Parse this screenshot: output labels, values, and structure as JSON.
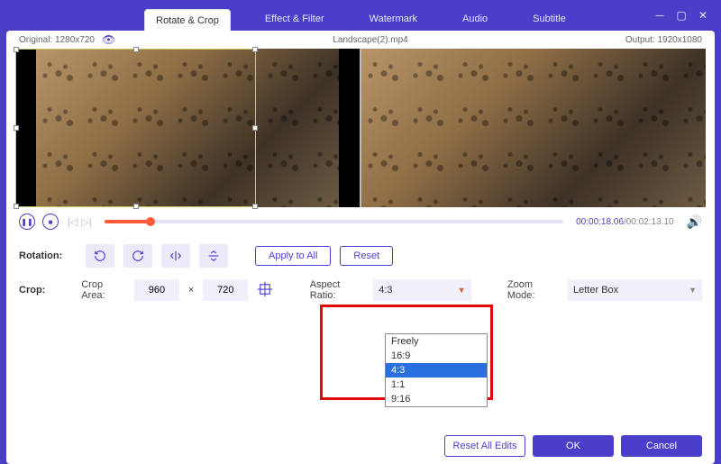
{
  "titlebar": {},
  "tabs": [
    "Rotate & Crop",
    "Effect & Filter",
    "Watermark",
    "Audio",
    "Subtitle"
  ],
  "active_tab_index": 0,
  "infobar": {
    "original_label": "Original:",
    "original_value": "1280x720",
    "filename": "Landscape(2).mp4",
    "output_label": "Output:",
    "output_value": "1920x1080"
  },
  "player": {
    "current": "00:00:18.06",
    "duration": "00:02:13.10"
  },
  "rotation": {
    "label": "Rotation:",
    "apply_all": "Apply to All",
    "reset": "Reset"
  },
  "crop": {
    "label": "Crop:",
    "area_label": "Crop Area:",
    "width": "960",
    "height": "720",
    "times": "×",
    "aspect_label": "Aspect Ratio:",
    "aspect_value": "4:3",
    "aspect_options": [
      "Freely",
      "16:9",
      "4:3",
      "1:1",
      "9:16"
    ],
    "aspect_selected_index": 2,
    "zoom_label": "Zoom Mode:",
    "zoom_value": "Letter Box"
  },
  "footer": {
    "reset_all": "Reset All Edits",
    "ok": "OK",
    "cancel": "Cancel"
  }
}
